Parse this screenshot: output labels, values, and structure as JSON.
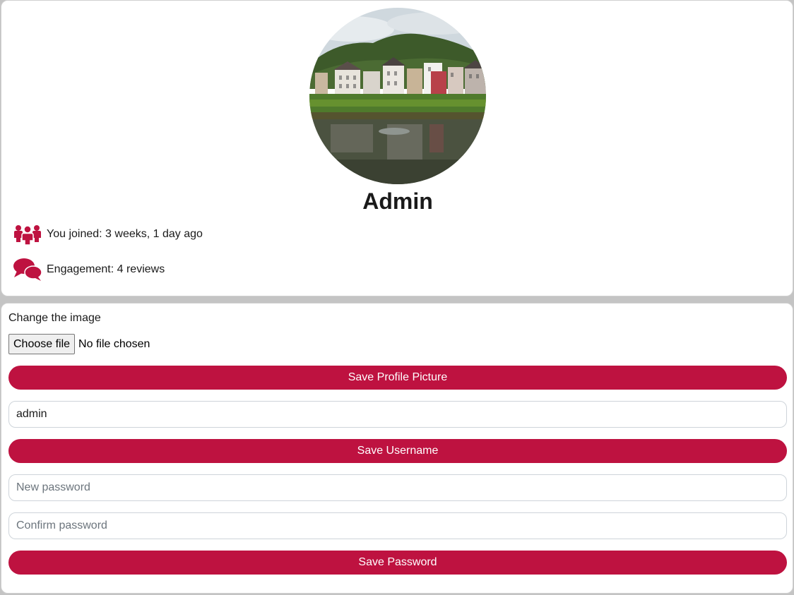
{
  "profile": {
    "username": "Admin",
    "avatar_alt": "profile picture",
    "joined_text": "You joined: 3 weeks, 1 day ago",
    "engagement_text": "Engagement: 4 reviews"
  },
  "icons": {
    "joined": "users-icon",
    "engagement": "comments-icon"
  },
  "form": {
    "image_label": "Change the image",
    "file_button_label": "Choose file",
    "file_status": "No file chosen",
    "save_picture_label": "Save Profile Picture",
    "username_value": "admin",
    "save_username_label": "Save Username",
    "new_password_placeholder": "New password",
    "confirm_password_placeholder": "Confirm password",
    "save_password_label": "Save Password"
  },
  "colors": {
    "accent": "#be1240",
    "background": "#c4c4c4",
    "card": "#ffffff"
  }
}
